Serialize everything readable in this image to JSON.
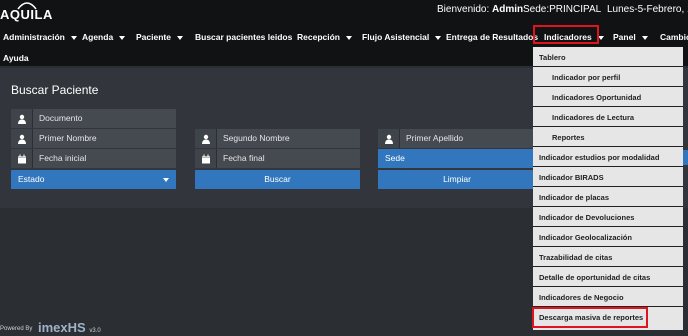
{
  "app": {
    "logo_text": "AQUILA"
  },
  "header": {
    "welcome_prefix": "Bienvenido:",
    "user": "Admin",
    "sede": "Sede:PRINCIPAL",
    "date": "Lunes-5-Febrero, 11:04"
  },
  "nav": {
    "items": [
      {
        "label": "Administración",
        "caret": true
      },
      {
        "label": "Agenda",
        "caret": true
      },
      {
        "label": "Paciente",
        "caret": true
      },
      {
        "label": "Buscar pacientes leidos",
        "caret": false
      },
      {
        "label": "Recepción",
        "caret": true
      },
      {
        "label": "Flujo Asistencial",
        "caret": true
      },
      {
        "label": "Entrega de Resultados",
        "caret": false
      },
      {
        "label": "Indicadores",
        "caret": true
      },
      {
        "label": "Panel",
        "caret": true
      },
      {
        "label": "Cambio",
        "caret": false
      }
    ],
    "help": "Ayuda"
  },
  "search": {
    "title": "Buscar Paciente",
    "documento": "Documento",
    "primer_nombre": "Primer Nombre",
    "segundo_nombre": "Segundo Nombre",
    "primer_apellido": "Primer Apellido",
    "fecha_inicial": "Fecha inicial",
    "fecha_final": "Fecha final",
    "estado": "Estado",
    "sede": "Sede",
    "buscar": "Buscar",
    "limpiar": "Limpiar"
  },
  "indicadores_menu": {
    "items": [
      {
        "label": "Tablero",
        "level": "top"
      },
      {
        "label": "Indicador por perfil",
        "level": "sub"
      },
      {
        "label": "Indicadores Oportunidad",
        "level": "sub"
      },
      {
        "label": "Indicadores de Lectura",
        "level": "sub"
      },
      {
        "label": "Reportes",
        "level": "sub"
      },
      {
        "label": "Indicador estudios por modalidad",
        "level": "top"
      },
      {
        "label": "Indicador BIRADS",
        "level": "top"
      },
      {
        "label": "Indicador de placas",
        "level": "top"
      },
      {
        "label": "Indicador de Devoluciones",
        "level": "top"
      },
      {
        "label": "Indicador Geolocalización",
        "level": "top"
      },
      {
        "label": "Trazabilidad de citas",
        "level": "top"
      },
      {
        "label": "Detalle de oportunidad de citas",
        "level": "top"
      },
      {
        "label": "Indicadores de Negocio",
        "level": "top"
      },
      {
        "label": "Descarga masiva de reportes",
        "level": "top"
      }
    ]
  },
  "footer": {
    "powered": "Powered By",
    "brand": "imexHS",
    "version": "v3.0"
  },
  "colors": {
    "accent": "#3277bd",
    "highlight": "#e0141e"
  }
}
